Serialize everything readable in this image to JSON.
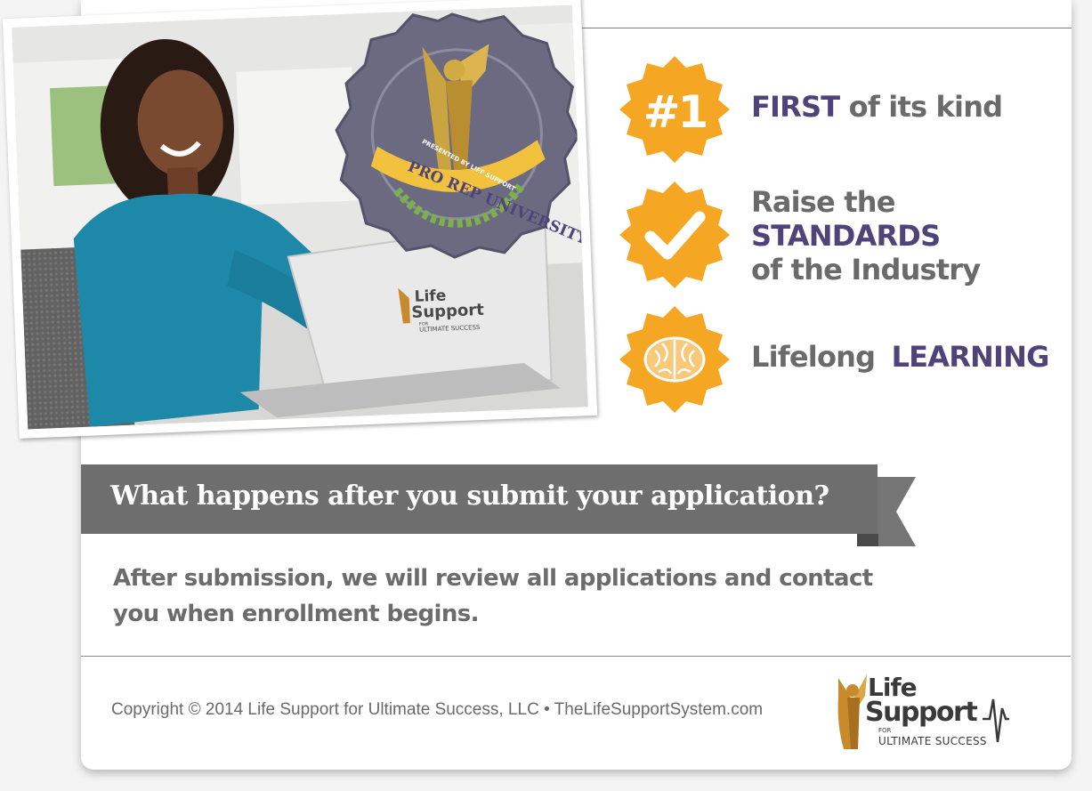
{
  "features": [
    {
      "icon": "number-one-badge-icon",
      "badge_text": "#1",
      "highlight": "FIRST",
      "rest": "of its kind"
    },
    {
      "icon": "checkmark-badge-icon",
      "line1": "Raise the",
      "highlight": "STANDARDS",
      "line3": "of the Industry"
    },
    {
      "icon": "brain-badge-icon",
      "prefix": "Lifelong",
      "highlight": "LEARNING"
    }
  ],
  "seal": {
    "top_text": "PRESENTED BY LIFE SUPPORT",
    "title": "PRO REP UNIVERSITY"
  },
  "laptop_logo": {
    "line1": "Life",
    "line2": "Support",
    "for": "FOR",
    "line3": "ULTIMATE SUCCESS"
  },
  "section": {
    "heading": "What happens after you submit your application?",
    "body": "After submission, we will review all applications and contact you when enrollment begins."
  },
  "footer": {
    "copyright": "Copyright © 2014 Life Support for Ultimate Success, LLC  • TheLifeSupportSystem.com",
    "logo": {
      "line1": "Life",
      "line2": "Support",
      "for": "FOR",
      "line3": "ULTIMATE SUCCESS"
    }
  },
  "colors": {
    "accent_orange": "#f5a623",
    "accent_purple": "#4e4479",
    "banner_gray": "#6e6e6e",
    "text_gray": "#6a6a6a"
  }
}
